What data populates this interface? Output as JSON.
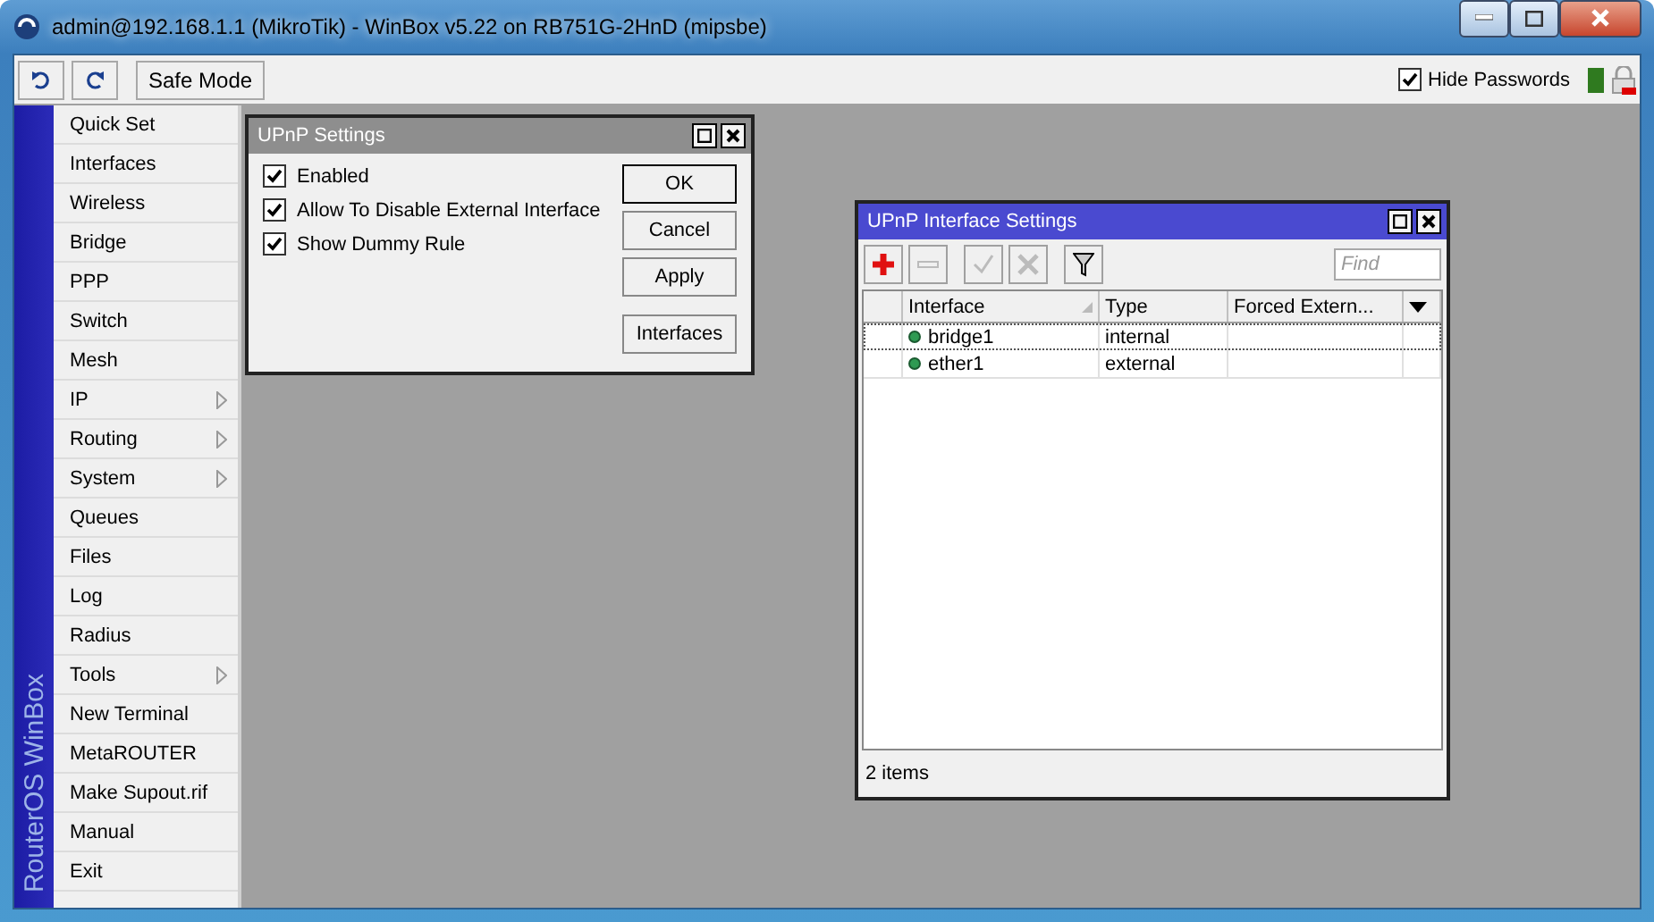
{
  "window": {
    "title": "admin@192.168.1.1 (MikroTik) - WinBox v5.22 on RB751G-2HnD (mipsbe)"
  },
  "toolbar": {
    "safe_mode": "Safe Mode",
    "hide_passwords": {
      "label": "Hide Passwords",
      "checked": true
    }
  },
  "sidebar": {
    "brand": "RouterOS WinBox",
    "items": [
      {
        "label": "Quick Set",
        "submenu": false
      },
      {
        "label": "Interfaces",
        "submenu": false
      },
      {
        "label": "Wireless",
        "submenu": false
      },
      {
        "label": "Bridge",
        "submenu": false
      },
      {
        "label": "PPP",
        "submenu": false
      },
      {
        "label": "Switch",
        "submenu": false
      },
      {
        "label": "Mesh",
        "submenu": false
      },
      {
        "label": "IP",
        "submenu": true
      },
      {
        "label": "Routing",
        "submenu": true
      },
      {
        "label": "System",
        "submenu": true
      },
      {
        "label": "Queues",
        "submenu": false
      },
      {
        "label": "Files",
        "submenu": false
      },
      {
        "label": "Log",
        "submenu": false
      },
      {
        "label": "Radius",
        "submenu": false
      },
      {
        "label": "Tools",
        "submenu": true
      },
      {
        "label": "New Terminal",
        "submenu": false
      },
      {
        "label": "MetaROUTER",
        "submenu": false
      },
      {
        "label": "Make Supout.rif",
        "submenu": false
      },
      {
        "label": "Manual",
        "submenu": false
      },
      {
        "label": "Exit",
        "submenu": false
      }
    ]
  },
  "upnp_settings": {
    "title": "UPnP Settings",
    "active": false,
    "options": [
      {
        "label": "Enabled",
        "checked": true
      },
      {
        "label": "Allow To Disable External Interface",
        "checked": true
      },
      {
        "label": "Show Dummy Rule",
        "checked": true
      }
    ],
    "buttons": [
      {
        "label": "OK",
        "default": true
      },
      {
        "label": "Cancel",
        "default": false
      },
      {
        "label": "Apply",
        "default": false
      },
      {
        "label": "Interfaces",
        "default": false
      }
    ]
  },
  "interface_settings": {
    "title": "UPnP Interface Settings",
    "active": true,
    "find": {
      "placeholder": "Find"
    },
    "columns": [
      "Interface",
      "Type",
      "Forced Extern..."
    ],
    "rows": [
      {
        "interface": "bridge1",
        "type": "internal",
        "selected": true
      },
      {
        "interface": "ether1",
        "type": "external",
        "selected": false
      }
    ],
    "status": "2 items"
  }
}
